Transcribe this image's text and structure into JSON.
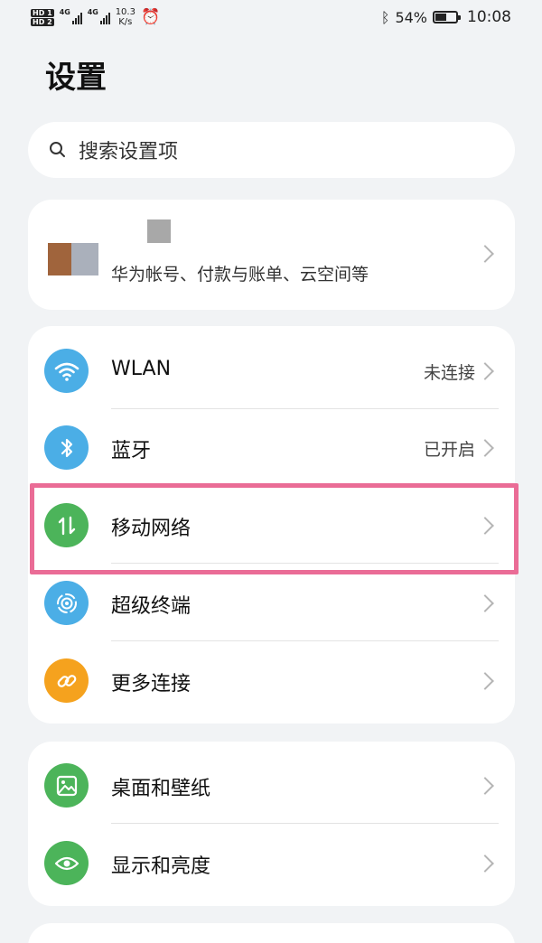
{
  "status_bar": {
    "hd1": "HD 1",
    "hd2": "HD 2",
    "net1": "4G",
    "net2": "4G",
    "speed_value": "10.3",
    "speed_unit": "K/s",
    "battery": "54%",
    "battery_level": 0.54,
    "time": "10:08"
  },
  "page": {
    "title": "设置"
  },
  "search": {
    "placeholder": "搜索设置项"
  },
  "account": {
    "subtitle": "华为帐号、付款与账单、云空间等"
  },
  "group1": {
    "items": [
      {
        "label": "WLAN",
        "value": "未连接",
        "icon": "wifi-icon",
        "color": "#4baee6"
      },
      {
        "label": "蓝牙",
        "value": "已开启",
        "icon": "bluetooth-icon",
        "color": "#4baee6"
      },
      {
        "label": "移动网络",
        "value": "",
        "icon": "mobile-data-icon",
        "color": "#4cb45a"
      },
      {
        "label": "超级终端",
        "value": "",
        "icon": "super-device-icon",
        "color": "#4baee6"
      },
      {
        "label": "更多连接",
        "value": "",
        "icon": "link-icon",
        "color": "#f5a21e"
      }
    ]
  },
  "group2": {
    "items": [
      {
        "label": "桌面和壁纸",
        "value": "",
        "icon": "wallpaper-icon",
        "color": "#4cb45a"
      },
      {
        "label": "显示和亮度",
        "value": "",
        "icon": "eye-icon",
        "color": "#4cb45a"
      }
    ]
  },
  "colors": {
    "background": "#f1f3f5",
    "highlight": "#ea6c96",
    "blue_icon": "#4baee6",
    "green_icon": "#4cb45a",
    "orange_icon": "#f5a21e"
  }
}
